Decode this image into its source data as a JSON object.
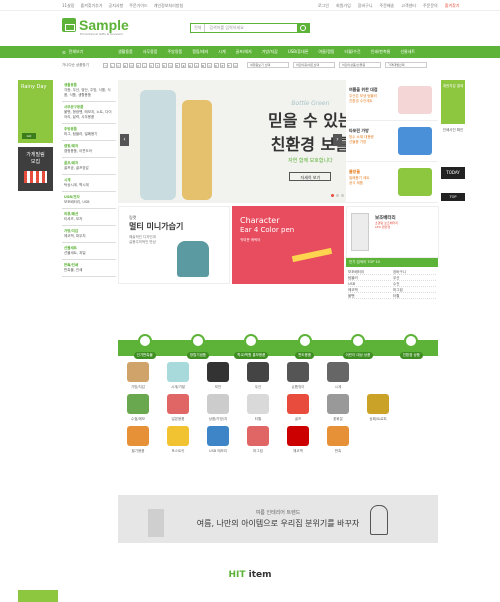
{
  "topbar": {
    "left": [
      "11살장",
      "즐겨찾기추가",
      "공지사항",
      "주문가이드",
      "개인정보처리방침"
    ],
    "right": [
      "로그인",
      "회원가입",
      "장바구니",
      "주문배송",
      "고객센터",
      "주문문의",
      "즐겨찾기"
    ]
  },
  "header": {
    "logo": "Sample",
    "logo_sub": "Promotional Gifts & Souvenir",
    "search_select": "전체",
    "search_placeholder": "검색어를 입력하세요"
  },
  "nav": {
    "all": "전체보기",
    "items": [
      "생활용품",
      "사무용품",
      "주방용품",
      "캠핑/레저",
      "시계",
      "골프/레저",
      "가방/지갑",
      "USB/휴대폰",
      "여름/캠핑",
      "타월/수건",
      "인쇄/판촉물",
      "선물세트"
    ]
  },
  "filter": {
    "label": "가나다순 상품찾기",
    "letters": [
      "ㄱ",
      "ㄴ",
      "ㄷ",
      "ㄹ",
      "ㅁ",
      "ㅂ",
      "ㅅ",
      "ㅇ",
      "ㅈ",
      "ㅊ",
      "ㅋ",
      "ㅌ",
      "ㅍ",
      "ㅎ",
      "A",
      "B",
      "C",
      "D",
      "E",
      "F",
      "G"
    ],
    "drops": [
      "여행용보기 선택",
      "어린이용/세트선택",
      "어린이상품/선물용",
      "가격대별선택"
    ]
  },
  "left": {
    "rainy": "Rainy Day",
    "rainy_cap": "GO",
    "store": "가게빌림\n모집"
  },
  "catmenu": [
    {
      "t": "생활용품",
      "d": "각종, 우산, 양산, 주방, 식품, 식품, 식품, 생활용품"
    },
    {
      "t": "사무문구용품",
      "d": "볼펜, 형광펜, 메모지, 노트, 다이어리, 달력, 사무용품"
    },
    {
      "t": "주방용품",
      "d": "머그, 텀블러, 밀폐용기"
    },
    {
      "t": "캠핑/레저",
      "d": "캠핑용품, 아웃도어"
    },
    {
      "t": "골프/레저",
      "d": "골프공, 골프장갑"
    },
    {
      "t": "시계",
      "d": "탁상시계, 벽시계"
    },
    {
      "t": "USB/전자",
      "d": "보조배터리, USB"
    },
    {
      "t": "의류/패션",
      "d": "티셔츠, 모자"
    },
    {
      "t": "가방/지갑",
      "d": "에코백, 파우치"
    },
    {
      "t": "선물세트",
      "d": "선물세트, 과일"
    },
    {
      "t": "판촉/인쇄",
      "d": "판촉물, 인쇄"
    }
  ],
  "hero": {
    "t1": "Bottle Green",
    "t2": "믿을 수 있는\n친환경 보틀",
    "t3": "자연 함께 보호합니다",
    "btn": "자세히 보기"
  },
  "side": [
    {
      "t": "여름을 위한 대접",
      "d": "우산은 보냉 텀블러\n친환경 수건세트"
    },
    {
      "t": "타포린 가방",
      "d": "방수 소재 대용량\n선물용 가방"
    },
    {
      "t": "물방울",
      "d": "밀폐용기 세트\n공식 제품"
    }
  ],
  "right": {
    "ad": "계란지갑 결제",
    "ttl": "인쇄사진 확인",
    "today": "TODAY",
    "top": "TOP"
  },
  "box1": {
    "t1": "링캣",
    "t2": "멀티 미니가습기",
    "t3": "예술적인 디자인과\n실용주의적인 만남"
  },
  "box2": {
    "t1": "Character",
    "t2": "Ear 4 Color pen",
    "t3": "귀여운 캐릭터"
  },
  "box3": {
    "t1": "보조배터리",
    "t2": "초경량 보조배터리\nLED 랜턴형"
  },
  "top5": {
    "hd": "인기 검색어 TOP 10",
    "rows": [
      "보조배터리",
      "장바구니",
      "텀블러",
      "우산",
      "USB",
      "수건",
      "에코백",
      "머그컵",
      "볼펜",
      "타월"
    ]
  },
  "cats": [
    "인기판촉물",
    "창립기념품",
    "학교/학원 홍보용품",
    "판도용품",
    "어린이 대상 상품",
    "친환경 상품"
  ],
  "grid": [
    {
      "n": "가방/지갑",
      "c": "#d0a36b"
    },
    {
      "n": "시계/가발",
      "c": "#a8dadc"
    },
    {
      "n": "보안",
      "c": "#333"
    },
    {
      "n": "우산",
      "c": "#444"
    },
    {
      "n": "손톱깎이",
      "c": "#555"
    },
    {
      "n": "시계",
      "c": "#666"
    },
    {
      "n": "",
      "c": "#fff"
    },
    {
      "n": "",
      "c": "#fff"
    },
    {
      "n": "수첩/메모",
      "c": "#6aa84f"
    },
    {
      "n": "일본용품",
      "c": "#e06666"
    },
    {
      "n": "상품/가방/지",
      "c": "#ccc"
    },
    {
      "n": "타월",
      "c": "#d9d9d9"
    },
    {
      "n": "골프",
      "c": "#e74c3c"
    },
    {
      "n": "꽃화분",
      "c": "#999"
    },
    {
      "n": "상패/트로피",
      "c": "#c9a227"
    },
    {
      "n": "",
      "c": "#fff"
    },
    {
      "n": "필기용품",
      "c": "#e69138"
    },
    {
      "n": "포스트잇",
      "c": "#f1c232"
    },
    {
      "n": "USB 메모리",
      "c": "#3d85c6"
    },
    {
      "n": "머그컵",
      "c": "#e06666"
    },
    {
      "n": "에코백",
      "c": "#cc0000"
    },
    {
      "n": "판촉",
      "c": "#e69138"
    },
    {
      "n": "",
      "c": "#fff"
    },
    {
      "n": "",
      "c": "#fff"
    }
  ],
  "banner": {
    "s": "여름 인테리어 트렌드",
    "m": "여름, 나만의 아이템으로 우리집 분위기를 바꾸자"
  },
  "hit": {
    "a": "HIT",
    "b": " item"
  }
}
